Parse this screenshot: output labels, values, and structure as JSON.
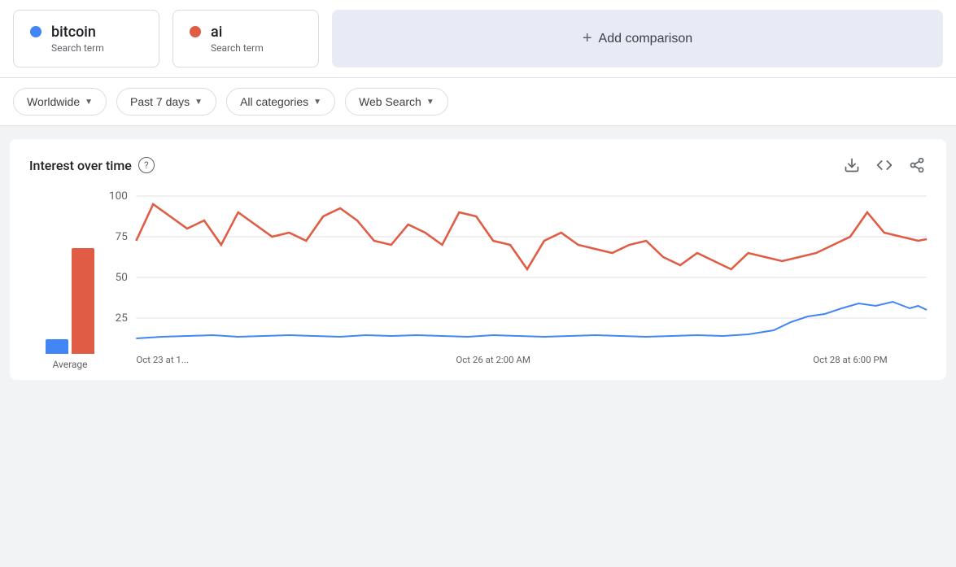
{
  "terms": [
    {
      "id": "bitcoin",
      "name": "bitcoin",
      "type": "Search term",
      "dotClass": "blue"
    },
    {
      "id": "ai",
      "name": "ai",
      "type": "Search term",
      "dotClass": "red"
    }
  ],
  "add_comparison_label": "Add comparison",
  "filters": {
    "region": {
      "label": "Worldwide",
      "icon": "chevron-down-icon"
    },
    "time": {
      "label": "Past 7 days",
      "icon": "chevron-down-icon"
    },
    "category": {
      "label": "All categories",
      "icon": "chevron-down-icon"
    },
    "search_type": {
      "label": "Web Search",
      "icon": "chevron-down-icon"
    }
  },
  "chart": {
    "title": "Interest over time",
    "help_label": "?",
    "actions": {
      "download": "download-icon",
      "embed": "embed-icon",
      "share": "share-icon"
    },
    "y_labels": [
      "100",
      "75",
      "50",
      "25"
    ],
    "x_labels": [
      "Oct 23 at 1...",
      "Oct 26 at 2:00 AM",
      "Oct 28 at 6:00 PM"
    ],
    "avg_label": "Average",
    "bars": [
      {
        "term": "bitcoin",
        "color": "#4285f4",
        "height_pct": 14
      },
      {
        "term": "ai",
        "color": "#e05c45",
        "height_pct": 65
      }
    ],
    "colors": {
      "ai": "#e05c45",
      "bitcoin": "#4285f4"
    }
  }
}
